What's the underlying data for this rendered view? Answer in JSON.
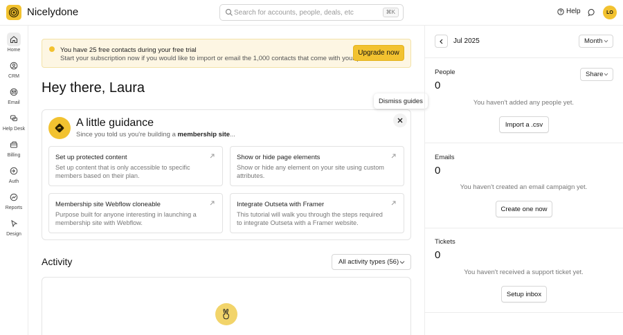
{
  "app": {
    "name": "Nicelydone",
    "accent_color": "#f2c230"
  },
  "topbar": {
    "search_placeholder": "Search for accounts, people, deals, etc",
    "search_shortcut": "⌘K",
    "help_label": "Help",
    "avatar_initials": "LO"
  },
  "sidebar": {
    "items": [
      {
        "label": "Home",
        "icon": "home-icon",
        "active": true
      },
      {
        "label": "CRM",
        "icon": "crm-icon"
      },
      {
        "label": "Email",
        "icon": "email-icon"
      },
      {
        "label": "Help Desk",
        "icon": "help-desk-icon"
      },
      {
        "label": "Billing",
        "icon": "billing-icon"
      },
      {
        "label": "Auth",
        "icon": "auth-icon"
      },
      {
        "label": "Reports",
        "icon": "reports-icon"
      },
      {
        "label": "Design",
        "icon": "design-icon"
      }
    ]
  },
  "banner": {
    "title": "You have 25 free contacts during your free trial",
    "subtitle": "Start your subscription now if you would like to import or email the 1,000 contacts that come with your plan.",
    "button_label": "Upgrade now"
  },
  "greeting": "Hey there, Laura",
  "guidance": {
    "title": "A little guidance",
    "subtitle_prefix": "Since you told us you're building a ",
    "subtitle_bold": "membership site",
    "subtitle_suffix": "...",
    "dismiss_tooltip": "Dismiss guides",
    "cards": [
      {
        "title": "Set up protected content",
        "description": "Set up content that is only accessible to specific members based on their plan."
      },
      {
        "title": "Show or hide page elements",
        "description": "Show or hide any element on your site using custom attributes."
      },
      {
        "title": "Membership site Webflow cloneable",
        "description": "Purpose built for anyone interesting in launching a membership site with Webflow."
      },
      {
        "title": "Integrate Outseta with Framer",
        "description": "This tutorial will walk you through the steps required to integrate Outseta with a Framer website."
      }
    ]
  },
  "activity": {
    "title": "Activity",
    "filter_label": "All activity types (56)"
  },
  "right_panel": {
    "period": "Jul 2025",
    "period_select": "Month",
    "share_label": "Share",
    "sections": [
      {
        "label": "People",
        "count": "0",
        "empty_text": "You haven't added any people yet.",
        "button": "Import a .csv"
      },
      {
        "label": "Emails",
        "count": "0",
        "empty_text": "You haven't created an email campaign yet.",
        "button": "Create one now"
      },
      {
        "label": "Tickets",
        "count": "0",
        "empty_text": "You haven't received a support ticket yet.",
        "button": "Setup inbox"
      }
    ]
  }
}
